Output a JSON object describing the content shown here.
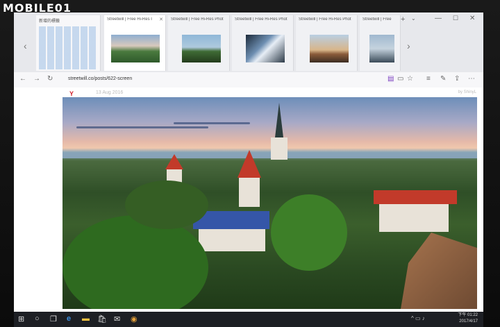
{
  "watermark": "MOBILE01",
  "browser": {
    "new_tab_label": "新增的標籤",
    "tabs": [
      {
        "title": "Streetwill | Free Hi-Res I"
      },
      {
        "title": "Streetwill | Free Hi-Res Phot"
      },
      {
        "title": "Streetwill | Free Hi-Res Phot"
      },
      {
        "title": "Streetwill | Free Hi-Res Phot"
      },
      {
        "title": "Streetwill | Free"
      }
    ],
    "new_tab_button": "+",
    "tabs_menu_icon": "⌄",
    "window_controls": {
      "minimize": "—",
      "maximize": "☐",
      "close": "✕"
    },
    "nav": {
      "back": "←",
      "forward": "→",
      "refresh": "↻"
    },
    "url": "streetwill.co/posts/622-screen",
    "toolbar_icons": [
      "reading-view-icon",
      "tabs-aside-icon",
      "favorite-star-icon",
      "hub-icon",
      "web-note-icon",
      "share-icon",
      "more-icon"
    ]
  },
  "page": {
    "brand_mark": "Y",
    "date": "13 Aug 2016",
    "byline": "by ShinyL"
  },
  "taskbar": {
    "start": "⊞",
    "search": "○",
    "task_view": "❐",
    "apps": [
      "e",
      "▬",
      "🛍",
      "✉",
      "◉"
    ],
    "tray": "^ ▭ ♪",
    "time": "下午 01:22",
    "date": "2017/4/17"
  }
}
